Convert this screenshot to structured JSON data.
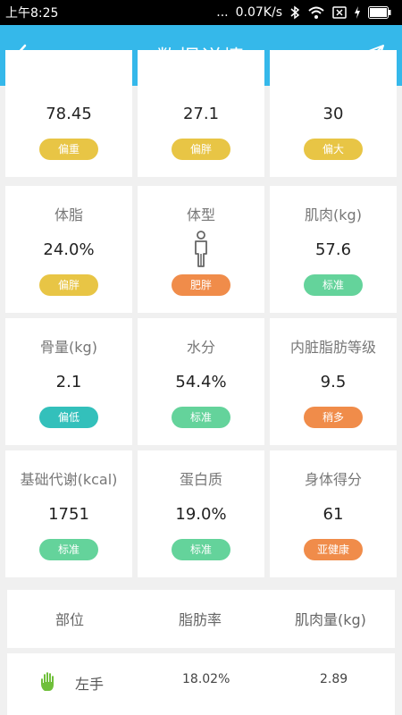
{
  "status_bar": {
    "time": "上午8:25",
    "dots": "...",
    "speed": "0.07K/s"
  },
  "header": {
    "title": "数据详情"
  },
  "colors": {
    "nav": "#35b8ea",
    "yellow": "#e8c545",
    "orange": "#f08c4a",
    "green": "#64d39b",
    "teal": "#33c0bb"
  },
  "metrics": [
    {
      "label": "",
      "value": "78.45",
      "badge": "偏重",
      "badge_color": "#e8c545"
    },
    {
      "label": "",
      "value": "27.1",
      "badge": "偏胖",
      "badge_color": "#e8c545"
    },
    {
      "label": "",
      "value": "30",
      "badge": "偏大",
      "badge_color": "#e8c545"
    },
    {
      "label": "体脂",
      "value": "24.0%",
      "badge": "偏胖",
      "badge_color": "#e8c545"
    },
    {
      "label": "体型",
      "value": "",
      "icon": "person-icon",
      "badge": "肥胖",
      "badge_color": "#f08c4a"
    },
    {
      "label": "肌肉(kg)",
      "value": "57.6",
      "badge": "标准",
      "badge_color": "#64d39b"
    },
    {
      "label": "骨量(kg)",
      "value": "2.1",
      "badge": "偏低",
      "badge_color": "#33c0bb"
    },
    {
      "label": "水分",
      "value": "54.4%",
      "badge": "标准",
      "badge_color": "#64d39b"
    },
    {
      "label": "内脏脂肪等级",
      "value": "9.5",
      "badge": "稍多",
      "badge_color": "#f08c4a"
    },
    {
      "label": "基础代谢(kcal)",
      "value": "1751",
      "badge": "标准",
      "badge_color": "#64d39b"
    },
    {
      "label": "蛋白质",
      "value": "19.0%",
      "badge": "标准",
      "badge_color": "#64d39b"
    },
    {
      "label": "身体得分",
      "value": "61",
      "badge": "亚健康",
      "badge_color": "#f08c4a"
    }
  ],
  "table": {
    "headers": [
      "部位",
      "脂肪率",
      "肌肉量(kg)"
    ],
    "rows": [
      {
        "icon": "hand-icon",
        "part": "左手",
        "fat_rate": "18.02%",
        "muscle": "2.89"
      }
    ]
  }
}
